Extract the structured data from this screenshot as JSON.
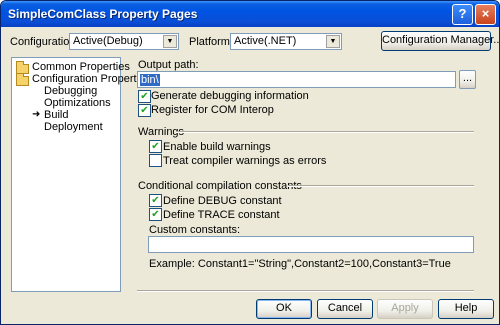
{
  "window": {
    "title": "SimpleComClass Property Pages",
    "help_button": "?",
    "close_button": "×"
  },
  "toolbar": {
    "configuration_label": "Configuration:",
    "configuration_value": "Active(Debug)",
    "platform_label": "Platform:",
    "platform_value": "Active(.NET)",
    "config_manager_button": "Configuration Manager..."
  },
  "tree": {
    "items": [
      {
        "label": "Common Properties"
      },
      {
        "label": "Configuration Properties"
      },
      {
        "label": "Debugging"
      },
      {
        "label": "Optimizations"
      },
      {
        "label": "Build"
      },
      {
        "label": "Deployment"
      }
    ]
  },
  "build": {
    "output_path_label": "Output path:",
    "output_path_value": "bin\\",
    "browse_button": "...",
    "generate_debug_label": "Generate debugging information",
    "generate_debug_checked": true,
    "register_com_label": "Register for COM Interop",
    "register_com_checked": true,
    "warnings_header": "Warnings",
    "enable_warnings_label": "Enable build warnings",
    "enable_warnings_checked": true,
    "treat_warnings_label": "Treat compiler warnings as errors",
    "treat_warnings_checked": false,
    "conditional_header": "Conditional compilation constants",
    "define_debug_label": "Define DEBUG constant",
    "define_debug_checked": true,
    "define_trace_label": "Define TRACE constant",
    "define_trace_checked": true,
    "custom_constants_label": "Custom constants:",
    "custom_constants_value": "",
    "example_text": "Example: Constant1=\"String\",Constant2=100,Constant3=True"
  },
  "buttons": {
    "ok": "OK",
    "cancel": "Cancel",
    "apply": "Apply",
    "help": "Help"
  }
}
